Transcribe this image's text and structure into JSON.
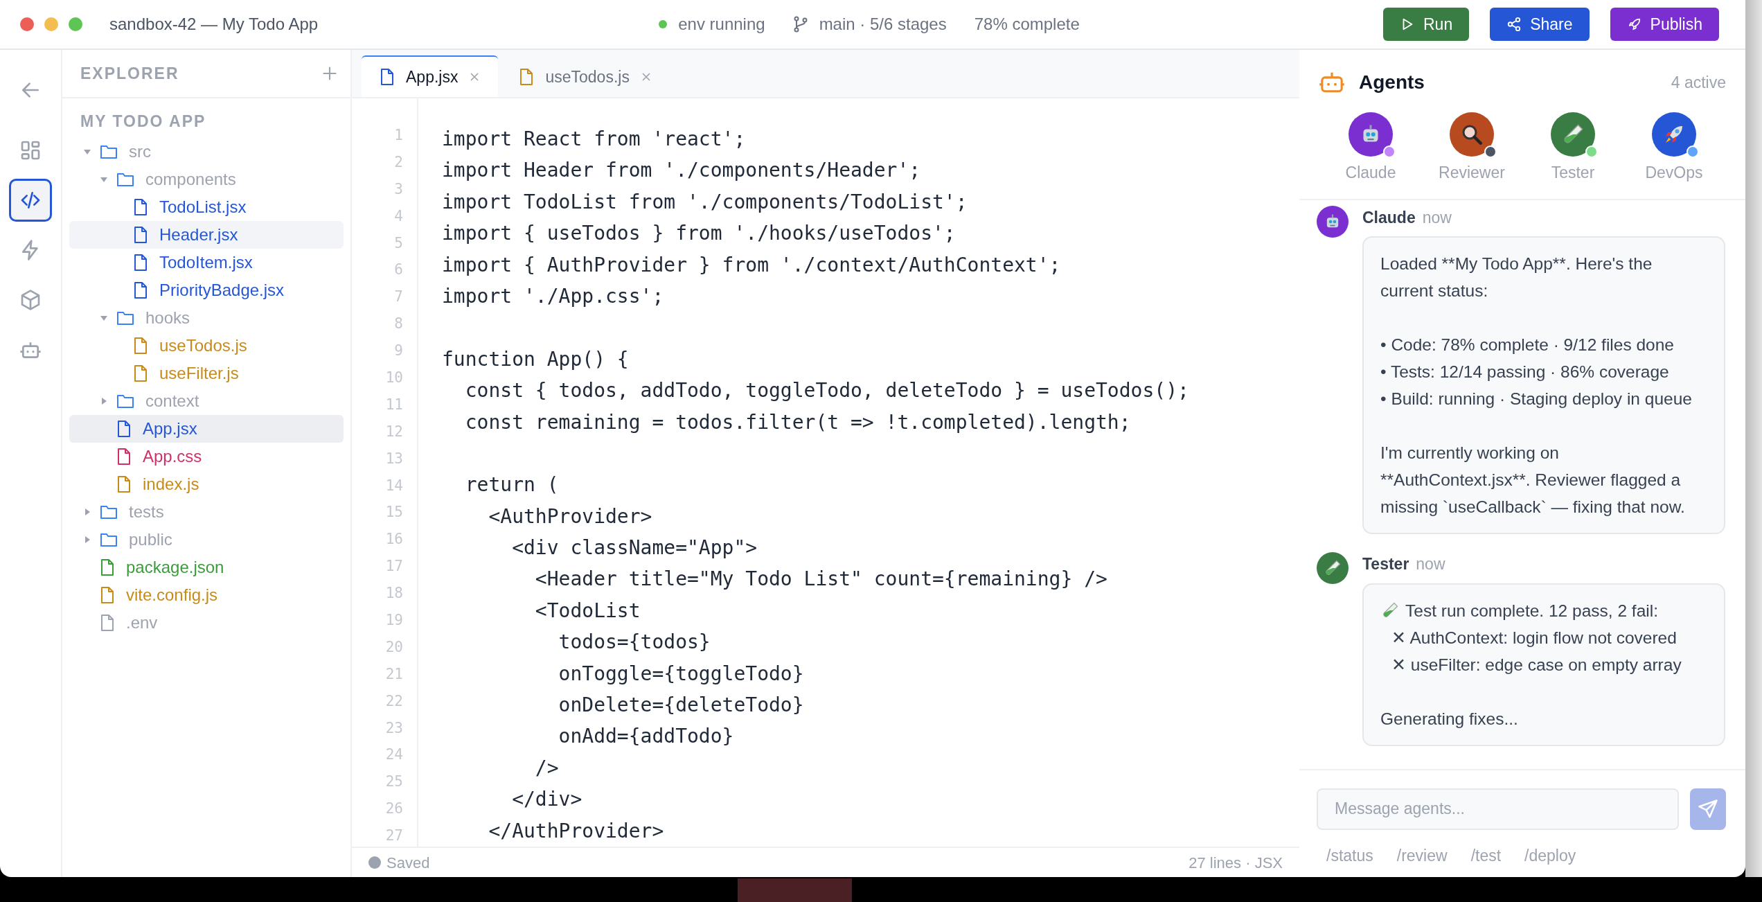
{
  "window": {
    "title": "sandbox-42 — My Todo App"
  },
  "toolbar": {
    "env_status": "env running",
    "branch": "main · 5/6 stages",
    "progress": "78% complete",
    "buttons": [
      {
        "label": "Run",
        "kind": "run"
      },
      {
        "label": "Share",
        "kind": "share"
      },
      {
        "label": "Publish",
        "kind": "publish"
      }
    ]
  },
  "activity_bar": [
    {
      "kind": "back",
      "selected": false
    },
    {
      "kind": "dashboard",
      "selected": false
    },
    {
      "kind": "code",
      "selected": true
    },
    {
      "kind": "bolt",
      "selected": false
    },
    {
      "kind": "package",
      "selected": false
    },
    {
      "kind": "bot",
      "selected": false
    }
  ],
  "explorer": {
    "title": "EXPLORER",
    "project": "MY TODO APP",
    "tree": [
      {
        "name": "src",
        "kind": "folder",
        "expanded": true,
        "selected": false,
        "hovered": false,
        "children": [
          {
            "name": "components",
            "kind": "folder",
            "expanded": true,
            "selected": false,
            "hovered": false,
            "children": [
              {
                "name": "TodoList.jsx",
                "kind": "jsx",
                "selected": false,
                "hovered": false
              },
              {
                "name": "Header.jsx",
                "kind": "jsx",
                "selected": false,
                "hovered": true
              },
              {
                "name": "TodoItem.jsx",
                "kind": "jsx",
                "selected": false,
                "hovered": false
              },
              {
                "name": "PriorityBadge.jsx",
                "kind": "jsx",
                "selected": false,
                "hovered": false
              }
            ]
          },
          {
            "name": "hooks",
            "kind": "folder",
            "expanded": true,
            "selected": false,
            "hovered": false,
            "children": [
              {
                "name": "useTodos.js",
                "kind": "js",
                "selected": false,
                "hovered": false
              },
              {
                "name": "useFilter.js",
                "kind": "js",
                "selected": false,
                "hovered": false
              }
            ]
          },
          {
            "name": "context",
            "kind": "folder",
            "expanded": false,
            "selected": false,
            "hovered": false
          },
          {
            "name": "App.jsx",
            "kind": "jsx",
            "selected": true,
            "hovered": false
          },
          {
            "name": "App.css",
            "kind": "css",
            "selected": false,
            "hovered": false
          },
          {
            "name": "index.js",
            "kind": "js",
            "selected": false,
            "hovered": false
          }
        ]
      },
      {
        "name": "tests",
        "kind": "folder",
        "expanded": false,
        "selected": false,
        "hovered": false
      },
      {
        "name": "public",
        "kind": "folder",
        "expanded": false,
        "selected": false,
        "hovered": false
      },
      {
        "name": "package.json",
        "kind": "json",
        "selected": false,
        "hovered": false
      },
      {
        "name": "vite.config.js",
        "kind": "js",
        "selected": false,
        "hovered": false
      },
      {
        "name": ".env",
        "kind": "env",
        "selected": false,
        "hovered": false
      }
    ]
  },
  "editor": {
    "tabs": [
      {
        "label": "App.jsx",
        "kind": "jsx",
        "selected": true
      },
      {
        "label": "useTodos.js",
        "kind": "js",
        "selected": false
      }
    ],
    "gutter": [
      "1",
      "2",
      "3",
      "4",
      "5",
      "6",
      "7",
      "8",
      "9",
      "10",
      "11",
      "12",
      "13",
      "14",
      "15",
      "16",
      "17",
      "18",
      "19",
      "20",
      "21",
      "22",
      "23",
      "24",
      "25",
      "26",
      "27"
    ],
    "lines": [
      {
        "kind": "code",
        "text": "import React from 'react';"
      },
      {
        "kind": "code",
        "text": "import Header from './components/Header';"
      },
      {
        "kind": "code",
        "text": "import TodoList from './components/TodoList';"
      },
      {
        "kind": "code",
        "text": "import { useTodos } from './hooks/useTodos';"
      },
      {
        "kind": "code",
        "text": "import { AuthProvider } from './context/AuthContext';"
      },
      {
        "kind": "code",
        "text": "import './App.css';"
      },
      {
        "kind": "blank"
      },
      {
        "kind": "code",
        "text": "function App() {"
      },
      {
        "kind": "code",
        "text": "  const { todos, addTodo, toggleTodo, deleteTodo } = useTodos();"
      },
      {
        "kind": "code",
        "text": "  const remaining = todos.filter(t => !t.completed).length;"
      },
      {
        "kind": "blank"
      },
      {
        "kind": "code",
        "text": "  return ("
      },
      {
        "kind": "code",
        "text": "    <AuthProvider>"
      },
      {
        "kind": "code",
        "text": "      <div className=\"App\">"
      },
      {
        "kind": "code",
        "text": "        <Header title=\"My Todo List\" count={remaining} />"
      },
      {
        "kind": "code",
        "text": "        <TodoList"
      },
      {
        "kind": "code",
        "text": "          todos={todos}"
      },
      {
        "kind": "code",
        "text": "          onToggle={toggleTodo}"
      },
      {
        "kind": "code",
        "text": "          onDelete={deleteTodo}"
      },
      {
        "kind": "code",
        "text": "          onAdd={addTodo}"
      },
      {
        "kind": "code",
        "text": "        />"
      },
      {
        "kind": "code",
        "text": "      </div>"
      },
      {
        "kind": "code",
        "text": "    </AuthProvider>"
      }
    ],
    "status": {
      "saved": "Saved",
      "info": "27 lines · JSX"
    }
  },
  "agents": {
    "title": "Agents",
    "count": "4 active",
    "agents": [
      {
        "name": "Claude",
        "kind": "robot",
        "color": "#7b2fd0",
        "status": {
          "color": "#c084fc"
        }
      },
      {
        "name": "Reviewer",
        "kind": "magnifier",
        "color": "#b84a1f",
        "status": {
          "color": "#4b5563"
        }
      },
      {
        "name": "Tester",
        "kind": "test-tube",
        "color": "#3a7d44",
        "status": {
          "color": "#7ddc8a"
        }
      },
      {
        "name": "DevOps",
        "kind": "rocket",
        "color": "#2456d6",
        "status": {
          "color": "#60a5fa"
        }
      }
    ],
    "messages": [
      {
        "author": "Claude",
        "kind": "robot",
        "color": "#7b2fd0",
        "time": "now",
        "paragraphs": [
          [
            {
              "kind": "plain",
              "text": "Loaded **My Todo App**. Here's the current status:"
            }
          ],
          [
            {
              "kind": "plain",
              "text": "• Code: 78% complete · 9/12 files done"
            },
            {
              "kind": "plain",
              "text": "• Tests: 12/14 passing · 86% coverage"
            },
            {
              "kind": "plain",
              "text": "• Build: running · Staging deploy in queue"
            }
          ],
          [
            {
              "kind": "plain",
              "text": "I'm currently working on **AuthContext.jsx**. Reviewer flagged a missing `useCallback` — fixing that now."
            }
          ]
        ]
      },
      {
        "author": "Tester",
        "kind": "test-tube",
        "color": "#3a7d44",
        "time": "now",
        "paragraphs": [
          [
            {
              "kind": "test-tube",
              "text": "Test run complete. 12 pass, 2 fail:"
            },
            {
              "kind": "indented",
              "text": "✕ AuthContext: login flow not covered"
            },
            {
              "kind": "indented",
              "text": "✕ useFilter: edge case on empty array"
            }
          ],
          [
            {
              "kind": "plain",
              "text": "Generating fixes..."
            }
          ]
        ]
      }
    ],
    "composer": {
      "placeholder": "Message agents...",
      "commands": [
        "/status",
        "/review",
        "/test",
        "/deploy"
      ]
    }
  }
}
